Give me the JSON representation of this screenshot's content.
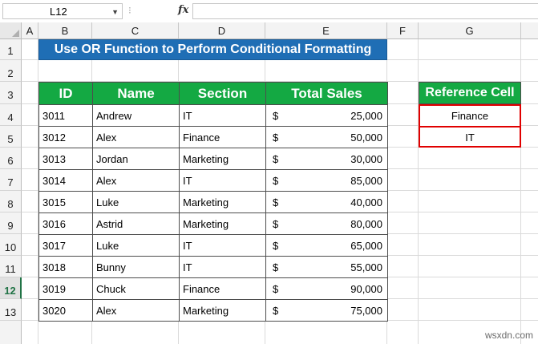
{
  "formula_bar": {
    "name_box": "L12",
    "fx_label": "fx",
    "formula": ""
  },
  "columns": [
    "A",
    "B",
    "C",
    "D",
    "E",
    "F",
    "G"
  ],
  "rows": [
    "1",
    "2",
    "3",
    "4",
    "5",
    "6",
    "7",
    "8",
    "9",
    "10",
    "11",
    "12",
    "13"
  ],
  "selected_row": "12",
  "title": "Use OR Function to Perform Conditional Formatting",
  "table": {
    "headers": [
      "ID",
      "Name",
      "Section",
      "Total Sales"
    ],
    "currency_symbol": "$",
    "rows": [
      {
        "id": "3011",
        "name": "Andrew",
        "section": "IT",
        "sales": "25,000"
      },
      {
        "id": "3012",
        "name": "Alex",
        "section": "Finance",
        "sales": "50,000"
      },
      {
        "id": "3013",
        "name": "Jordan",
        "section": "Marketing",
        "sales": "30,000"
      },
      {
        "id": "3014",
        "name": "Alex",
        "section": "IT",
        "sales": "85,000"
      },
      {
        "id": "3015",
        "name": "Luke",
        "section": "Marketing",
        "sales": "40,000"
      },
      {
        "id": "3016",
        "name": "Astrid",
        "section": "Marketing",
        "sales": "80,000"
      },
      {
        "id": "3017",
        "name": "Luke",
        "section": "IT",
        "sales": "65,000"
      },
      {
        "id": "3018",
        "name": "Bunny",
        "section": "IT",
        "sales": "55,000"
      },
      {
        "id": "3019",
        "name": "Chuck",
        "section": "Finance",
        "sales": "90,000"
      },
      {
        "id": "3020",
        "name": "Alex",
        "section": "Marketing",
        "sales": "75,000"
      }
    ]
  },
  "reference": {
    "header": "Reference Cell",
    "values": [
      "Finance",
      "IT"
    ]
  },
  "watermark": "wsxdn.com",
  "colors": {
    "title_bg": "#1f6eb5",
    "header_bg": "#14a943",
    "reference_border": "#e00000",
    "selected_row": "#217346"
  }
}
